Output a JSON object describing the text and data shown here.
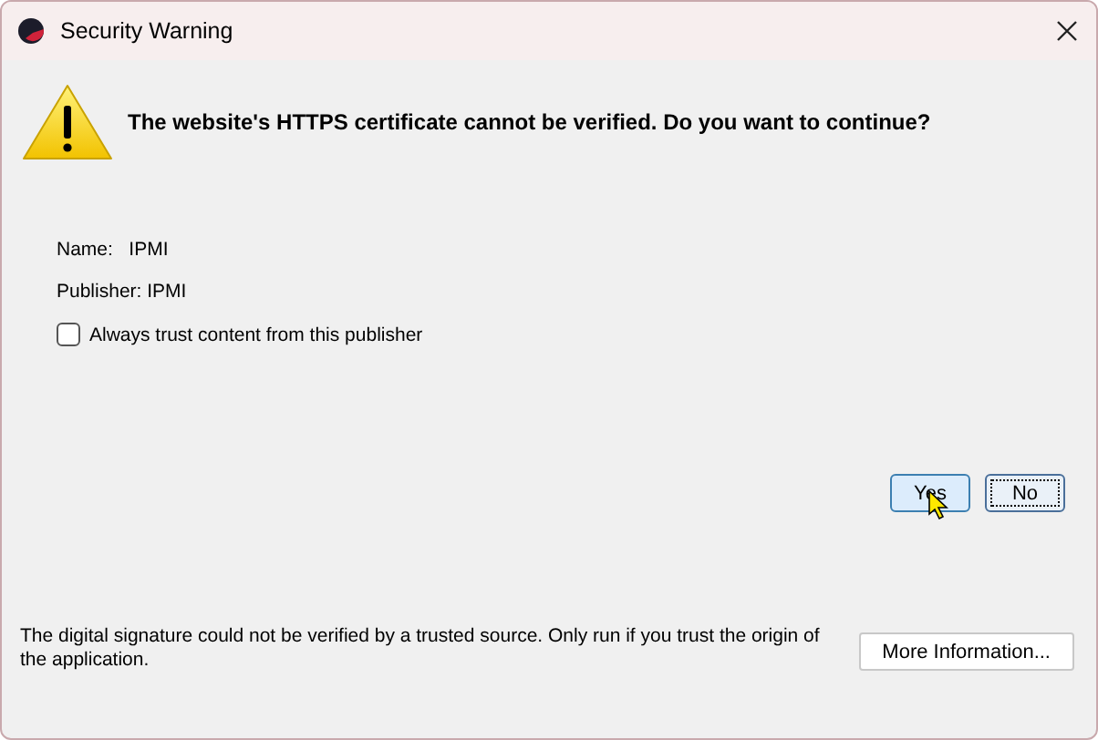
{
  "window": {
    "title": "Security Warning"
  },
  "message": "The website's HTTPS certificate cannot be verified. Do you want to continue?",
  "details": [
    {
      "label": "Name:",
      "value": "IPMI"
    },
    {
      "label": "Publisher:",
      "value": "IPMI"
    }
  ],
  "trust_checkbox": {
    "label": "Always trust content from this publisher",
    "checked": false
  },
  "buttons": [
    {
      "label": "Yes",
      "focused": false,
      "hovered": true
    },
    {
      "label": "No",
      "focused": true,
      "hovered": false
    }
  ],
  "footer": {
    "text": "The digital signature could not be verified by a trusted source. Only run if you trust the origin of the application.",
    "button": "More Information..."
  }
}
